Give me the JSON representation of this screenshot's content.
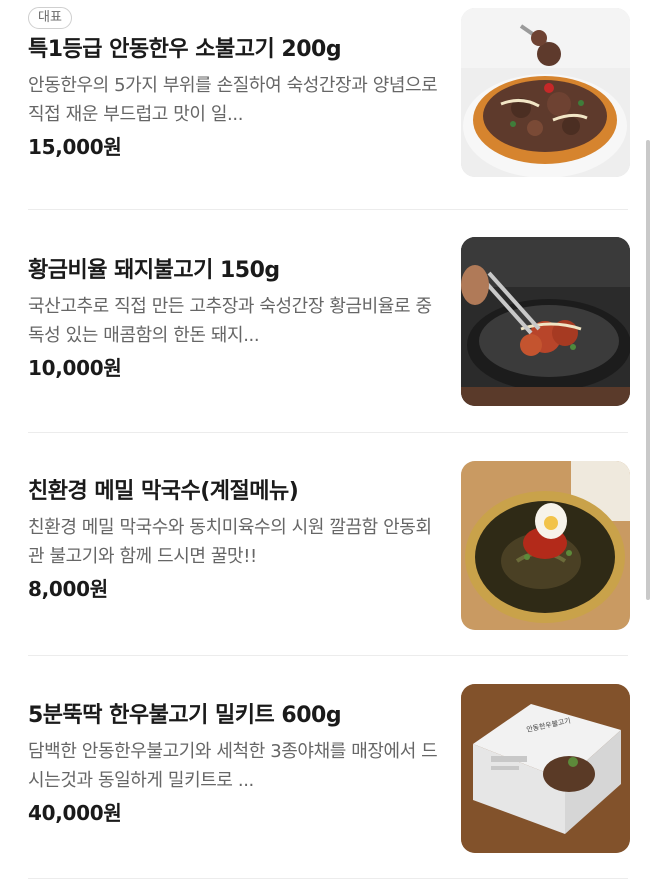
{
  "items": [
    {
      "badge": "대표",
      "title": "특1등급 안동한우 소불고기 200g",
      "description": "안동한우의 5가지 부위를 손질하여 숙성간장과 양념으로 직접 재운 부드럽고 맛이 일...",
      "price": "15,000원",
      "image_icon": "beef-bulgogi-photo"
    },
    {
      "title": "황금비율 돼지불고기 150g",
      "description": "국산고추로 직접 만든 고추장과 숙성간장 황금비율로 중독성 있는 매콤함의 한돈 돼지...",
      "price": "10,000원",
      "image_icon": "pork-bulgogi-photo"
    },
    {
      "title": "친환경 메밀 막국수(계절메뉴)",
      "description": "친환경 메밀 막국수와 동치미육수의 시원 깔끔함 안동회관 불고기와 함께 드시면 꿀맛!!",
      "price": "8,000원",
      "image_icon": "buckwheat-noodle-photo"
    },
    {
      "title": "5분뚝딱 한우불고기 밀키트 600g",
      "description": "담백한 안동한우불고기와 세척한 3종야채를 매장에서 드시는것과 동일하게 밀키트로 ...",
      "price": "40,000원",
      "image_icon": "meal-kit-photo",
      "package_label": "안동한우불고기"
    }
  ]
}
